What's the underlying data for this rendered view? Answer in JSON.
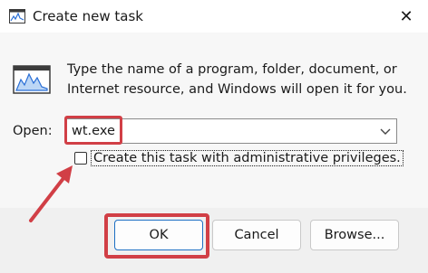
{
  "dialog": {
    "title": "Create new task",
    "close_glyph": "✕",
    "icons": {
      "title": "run-program-icon",
      "program": "program-window-icon",
      "close": "close-icon",
      "dropdown": "chevron-down-icon"
    },
    "description": "Type the name of a program, folder, document, or Internet resource, and Windows will open it for you.",
    "open_label": "Open:",
    "open_value": "wt.exe",
    "admin_checkbox_label": "Create this task with administrative privileges.",
    "admin_checked": false,
    "buttons": {
      "ok": "OK",
      "cancel": "Cancel",
      "browse": "Browse..."
    }
  },
  "annotation": {
    "highlight_color": "#d13f46"
  }
}
